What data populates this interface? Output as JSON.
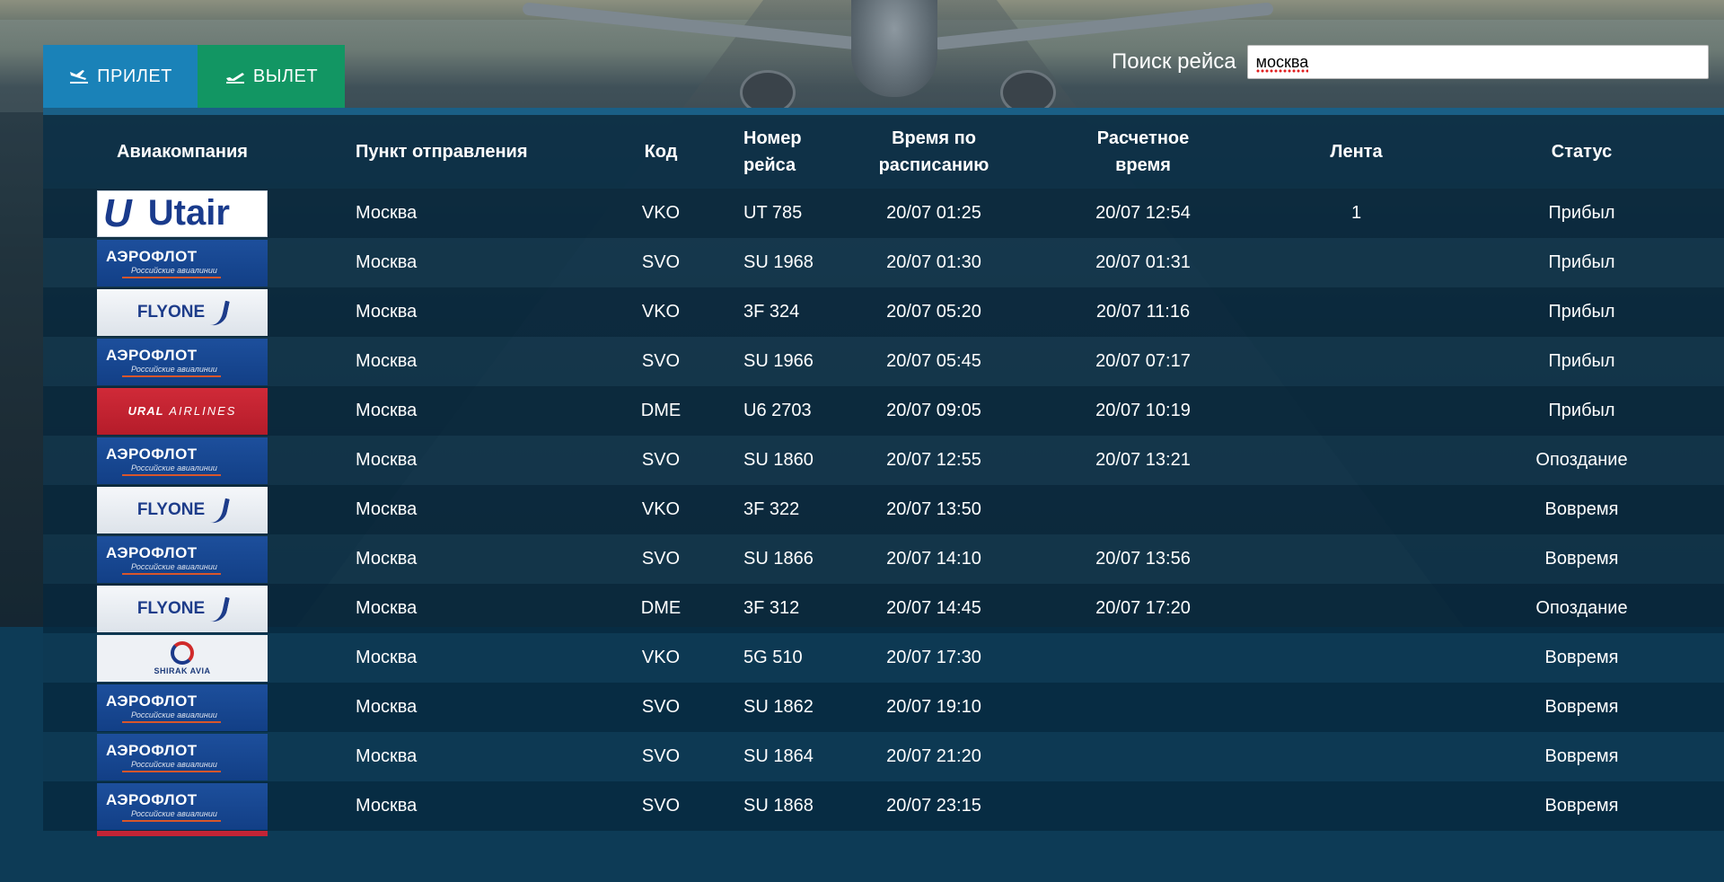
{
  "tabs": {
    "arrivals": "ПРИЛЕТ",
    "departures": "ВЫЛЕТ"
  },
  "search": {
    "label": "Поиск рейса",
    "value": "москва"
  },
  "table": {
    "headers": {
      "airline": "Авиакомпания",
      "origin": "Пункт отправления",
      "code": "Код",
      "flight_line1": "Номер",
      "flight_line2": "рейса",
      "sched_line1": "Время по",
      "sched_line2": "расписанию",
      "est_line1": "Расчетное",
      "est_line2": "время",
      "belt": "Лента",
      "status": "Статус"
    },
    "rows": [
      {
        "airline": "Utair",
        "logo": "utair",
        "origin": "Москва",
        "code": "VKO",
        "flight": "UT 785",
        "sched": "20/07 01:25",
        "est": "20/07 12:54",
        "belt": "1",
        "status": "Прибыл"
      },
      {
        "airline": "АЭРОФЛОТ",
        "logo": "aeroflot",
        "origin": "Москва",
        "code": "SVO",
        "flight": "SU 1968",
        "sched": "20/07 01:30",
        "est": "20/07 01:31",
        "belt": "",
        "status": "Прибыл"
      },
      {
        "airline": "FLYONE",
        "logo": "flyone",
        "origin": "Москва",
        "code": "VKO",
        "flight": "3F 324",
        "sched": "20/07 05:20",
        "est": "20/07 11:16",
        "belt": "",
        "status": "Прибыл"
      },
      {
        "airline": "АЭРОФЛОТ",
        "logo": "aeroflot",
        "origin": "Москва",
        "code": "SVO",
        "flight": "SU 1966",
        "sched": "20/07 05:45",
        "est": "20/07 07:17",
        "belt": "",
        "status": "Прибыл"
      },
      {
        "airline": "URAL AIRLINES",
        "logo": "ural",
        "origin": "Москва",
        "code": "DME",
        "flight": "U6 2703",
        "sched": "20/07 09:05",
        "est": "20/07 10:19",
        "belt": "",
        "status": "Прибыл"
      },
      {
        "airline": "АЭРОФЛОТ",
        "logo": "aeroflot",
        "origin": "Москва",
        "code": "SVO",
        "flight": "SU 1860",
        "sched": "20/07 12:55",
        "est": "20/07 13:21",
        "belt": "",
        "status": "Опоздание"
      },
      {
        "airline": "FLYONE",
        "logo": "flyone",
        "origin": "Москва",
        "code": "VKO",
        "flight": "3F 322",
        "sched": "20/07 13:50",
        "est": "",
        "belt": "",
        "status": "Вовремя"
      },
      {
        "airline": "АЭРОФЛОТ",
        "logo": "aeroflot",
        "origin": "Москва",
        "code": "SVO",
        "flight": "SU 1866",
        "sched": "20/07 14:10",
        "est": "20/07 13:56",
        "belt": "",
        "status": "Вовремя"
      },
      {
        "airline": "FLYONE",
        "logo": "flyone",
        "origin": "Москва",
        "code": "DME",
        "flight": "3F 312",
        "sched": "20/07 14:45",
        "est": "20/07 17:20",
        "belt": "",
        "status": "Опоздание"
      },
      {
        "airline": "SHIRAK AVIA",
        "logo": "shirak",
        "origin": "Москва",
        "code": "VKO",
        "flight": "5G 510",
        "sched": "20/07 17:30",
        "est": "",
        "belt": "",
        "status": "Вовремя"
      },
      {
        "airline": "АЭРОФЛОТ",
        "logo": "aeroflot",
        "origin": "Москва",
        "code": "SVO",
        "flight": "SU 1862",
        "sched": "20/07 19:10",
        "est": "",
        "belt": "",
        "status": "Вовремя"
      },
      {
        "airline": "АЭРОФЛОТ",
        "logo": "aeroflot",
        "origin": "Москва",
        "code": "SVO",
        "flight": "SU 1864",
        "sched": "20/07 21:20",
        "est": "",
        "belt": "",
        "status": "Вовремя"
      },
      {
        "airline": "АЭРОФЛОТ",
        "logo": "aeroflot",
        "origin": "Москва",
        "code": "SVO",
        "flight": "SU 1868",
        "sched": "20/07 23:15",
        "est": "",
        "belt": "",
        "status": "Вовремя"
      }
    ]
  },
  "logo_text": {
    "aeroflot_sub": "Российские авиалинии",
    "ural_a": "URAL",
    "ural_b": "AIRLINES",
    "shirak": "SHIRAK AVIA"
  },
  "colors": {
    "arrivals_tab": "#1a82b8",
    "departures_tab": "#129663",
    "board_bg": "#0d3b56"
  }
}
